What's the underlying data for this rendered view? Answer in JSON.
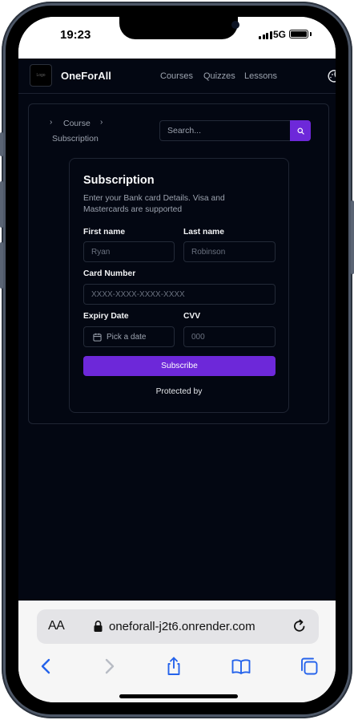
{
  "status_bar": {
    "time": "19:23",
    "network": "5G"
  },
  "nav": {
    "brand": "OneForAll",
    "logo_text": "Logo",
    "links": [
      "Courses",
      "Quizzes",
      "Lessons"
    ]
  },
  "breadcrumb": {
    "items": [
      "Course",
      "Subscription"
    ]
  },
  "search": {
    "placeholder": "Search..."
  },
  "subscription": {
    "title": "Subscription",
    "description": "Enter your Bank card Details. Visa and Mastercards are supported",
    "first_name_label": "First name",
    "first_name_placeholder": "Ryan",
    "last_name_label": "Last name",
    "last_name_placeholder": "Robinson",
    "card_number_label": "Card Number",
    "card_number_placeholder": "XXXX-XXXX-XXXX-XXXX",
    "expiry_label": "Expiry Date",
    "expiry_placeholder": "Pick a date",
    "cvv_label": "CVV",
    "cvv_placeholder": "000",
    "subscribe_label": "Subscribe",
    "protected_text": "Protected by"
  },
  "safari": {
    "aa_label": "AA",
    "url": "oneforall-j2t6.onrender.com"
  },
  "colors": {
    "page_background": "#030712",
    "accent": "#6d28d9",
    "border": "#1f2533"
  }
}
